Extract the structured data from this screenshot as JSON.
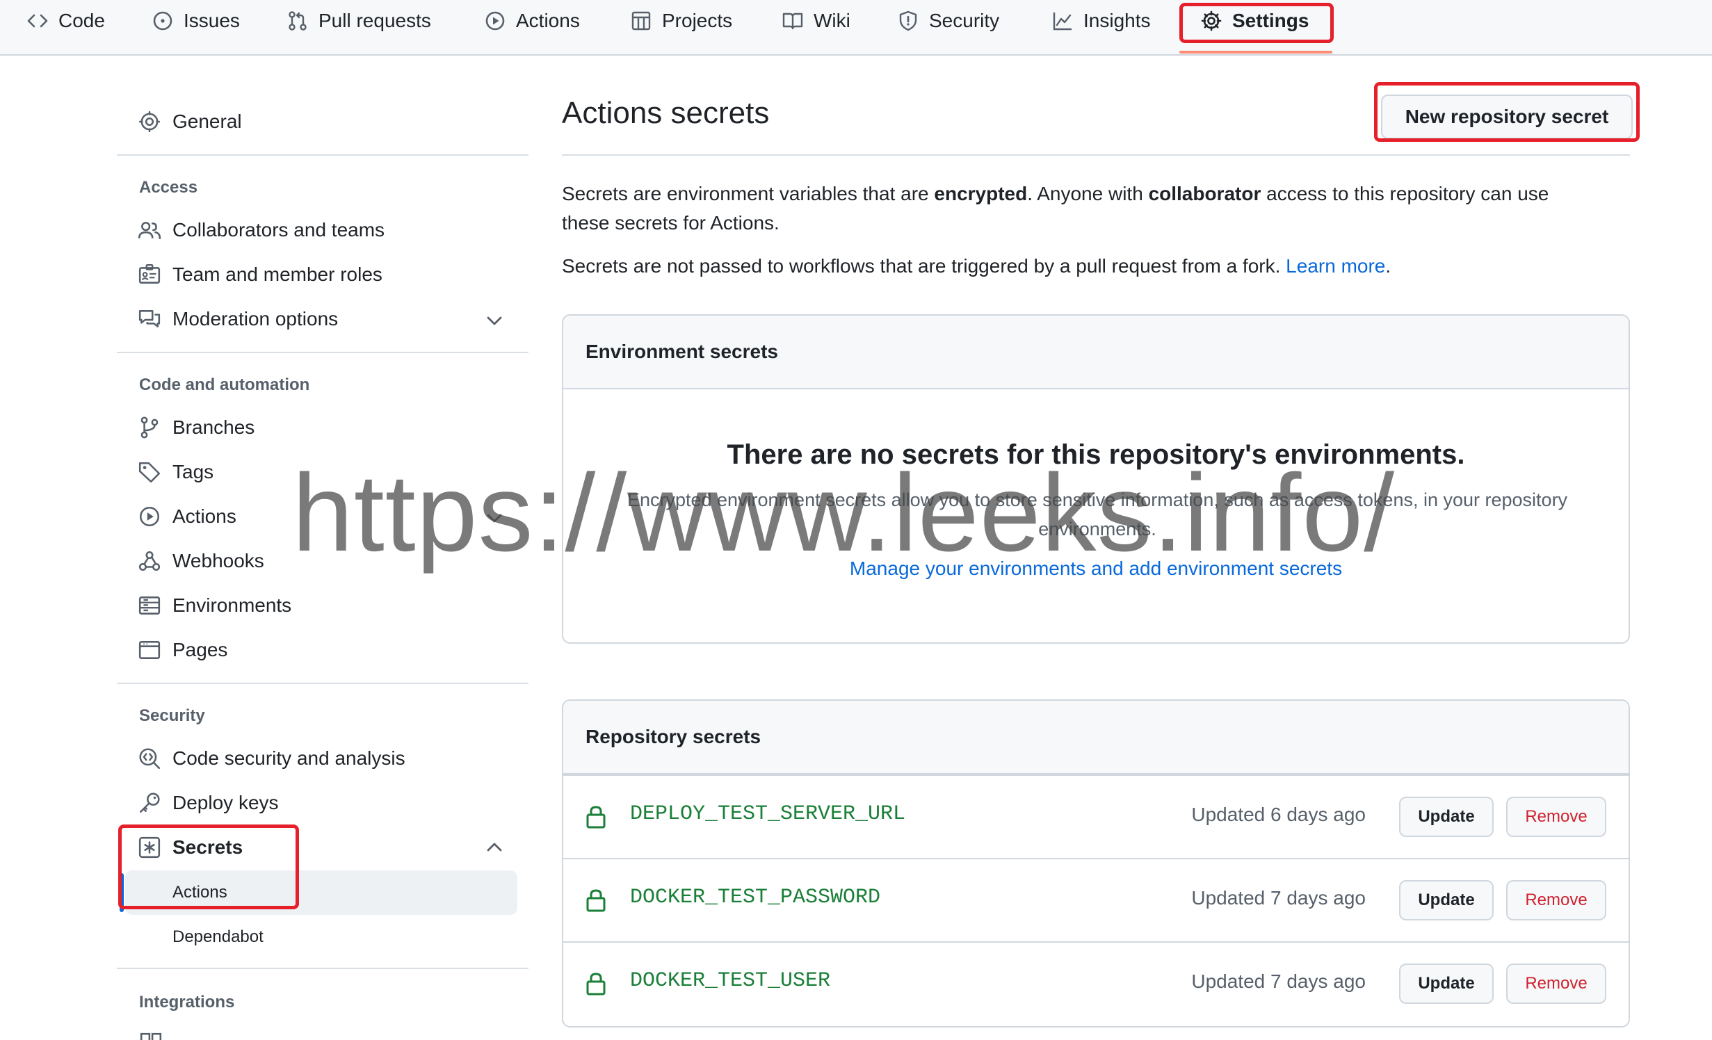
{
  "topnav": {
    "tabs": [
      {
        "label": "Code",
        "icon": "code-icon"
      },
      {
        "label": "Issues",
        "icon": "issue-icon"
      },
      {
        "label": "Pull requests",
        "icon": "pull-request-icon"
      },
      {
        "label": "Actions",
        "icon": "play-icon"
      },
      {
        "label": "Projects",
        "icon": "table-icon"
      },
      {
        "label": "Wiki",
        "icon": "book-icon"
      },
      {
        "label": "Security",
        "icon": "shield-icon"
      },
      {
        "label": "Insights",
        "icon": "graph-icon"
      },
      {
        "label": "Settings",
        "icon": "gear-icon",
        "active": true
      }
    ]
  },
  "sidebar": {
    "general": "General",
    "access_heading": "Access",
    "access": [
      "Collaborators and teams",
      "Team and member roles",
      "Moderation options"
    ],
    "code_heading": "Code and automation",
    "code": [
      "Branches",
      "Tags",
      "Actions",
      "Webhooks",
      "Environments",
      "Pages"
    ],
    "security_heading": "Security",
    "security": [
      "Code security and analysis",
      "Deploy keys",
      "Secrets"
    ],
    "secrets_sub": [
      "Actions",
      "Dependabot"
    ],
    "integrations_heading": "Integrations"
  },
  "main": {
    "title": "Actions secrets",
    "new_button": "New repository secret",
    "p1_a": "Secrets are environment variables that are ",
    "p1_b": "encrypted",
    "p1_c": ". Anyone with ",
    "p1_d": "collaborator",
    "p1_e": " access to this repository can use",
    "p1_f": "these secrets for Actions.",
    "p2_a": "Secrets are not passed to workflows that are triggered by a pull request from a fork. ",
    "p2_link": "Learn more",
    "p2_end": ".",
    "env_box": {
      "heading": "Environment secrets",
      "empty_title": "There are no secrets for this repository's environments.",
      "empty_desc": "Encrypted environment secrets allow you to store sensitive information, such as access tokens, in your repository environments.",
      "link": "Manage your environments and add environment secrets"
    },
    "repo_box": {
      "heading": "Repository secrets",
      "secrets": [
        {
          "name": "DEPLOY_TEST_SERVER_URL",
          "updated": "Updated 6 days ago"
        },
        {
          "name": "DOCKER_TEST_PASSWORD",
          "updated": "Updated 7 days ago"
        },
        {
          "name": "DOCKER_TEST_USER",
          "updated": "Updated 7 days ago"
        }
      ],
      "update_label": "Update",
      "remove_label": "Remove"
    }
  },
  "watermark": "https://www.leeks.info/",
  "colors": {
    "accent": "#0969da",
    "secret_name": "#1a7f37",
    "danger": "#cf222e",
    "highlight": "#e5202a",
    "tab_underline": "#fd8c73"
  }
}
